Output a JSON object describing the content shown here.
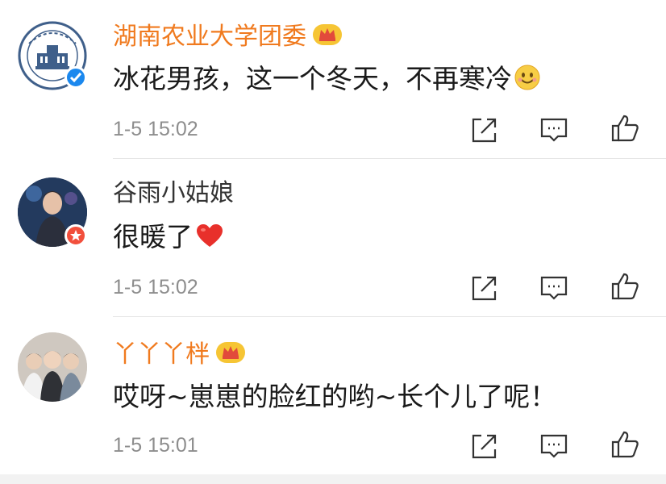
{
  "comments": [
    {
      "username": "湖南农业大学团委",
      "content": "冰花男孩，这一个冬天，不再寒冷",
      "timestamp": "1-5 15:02",
      "avatar": "university-logo",
      "badge": "verified",
      "vip": true,
      "emoji": "smile-emoji"
    },
    {
      "username": "谷雨小姑娘",
      "content": "很暖了",
      "timestamp": "1-5 15:02",
      "avatar": "photo-avatar",
      "badge": "star",
      "vip": false,
      "emoji": "red-heart"
    },
    {
      "username": "丫丫丫柈",
      "content": "哎呀~崽崽的脸红的哟~长个儿了呢！",
      "timestamp": "1-5 15:01",
      "avatar": "group-photo-avatar",
      "badge": "",
      "vip": true,
      "emoji": ""
    }
  ],
  "colors": {
    "vip_name": "#f07a1e",
    "plain_name": "#333333",
    "content": "#1a1a1a",
    "timestamp": "#8d8d8d",
    "icon": "#333333",
    "verified_badge": "#1b88ee",
    "star_badge": "#f24f3c",
    "heart": "#e8302b"
  },
  "actions": [
    "share-icon",
    "reply-icon",
    "like-icon"
  ]
}
